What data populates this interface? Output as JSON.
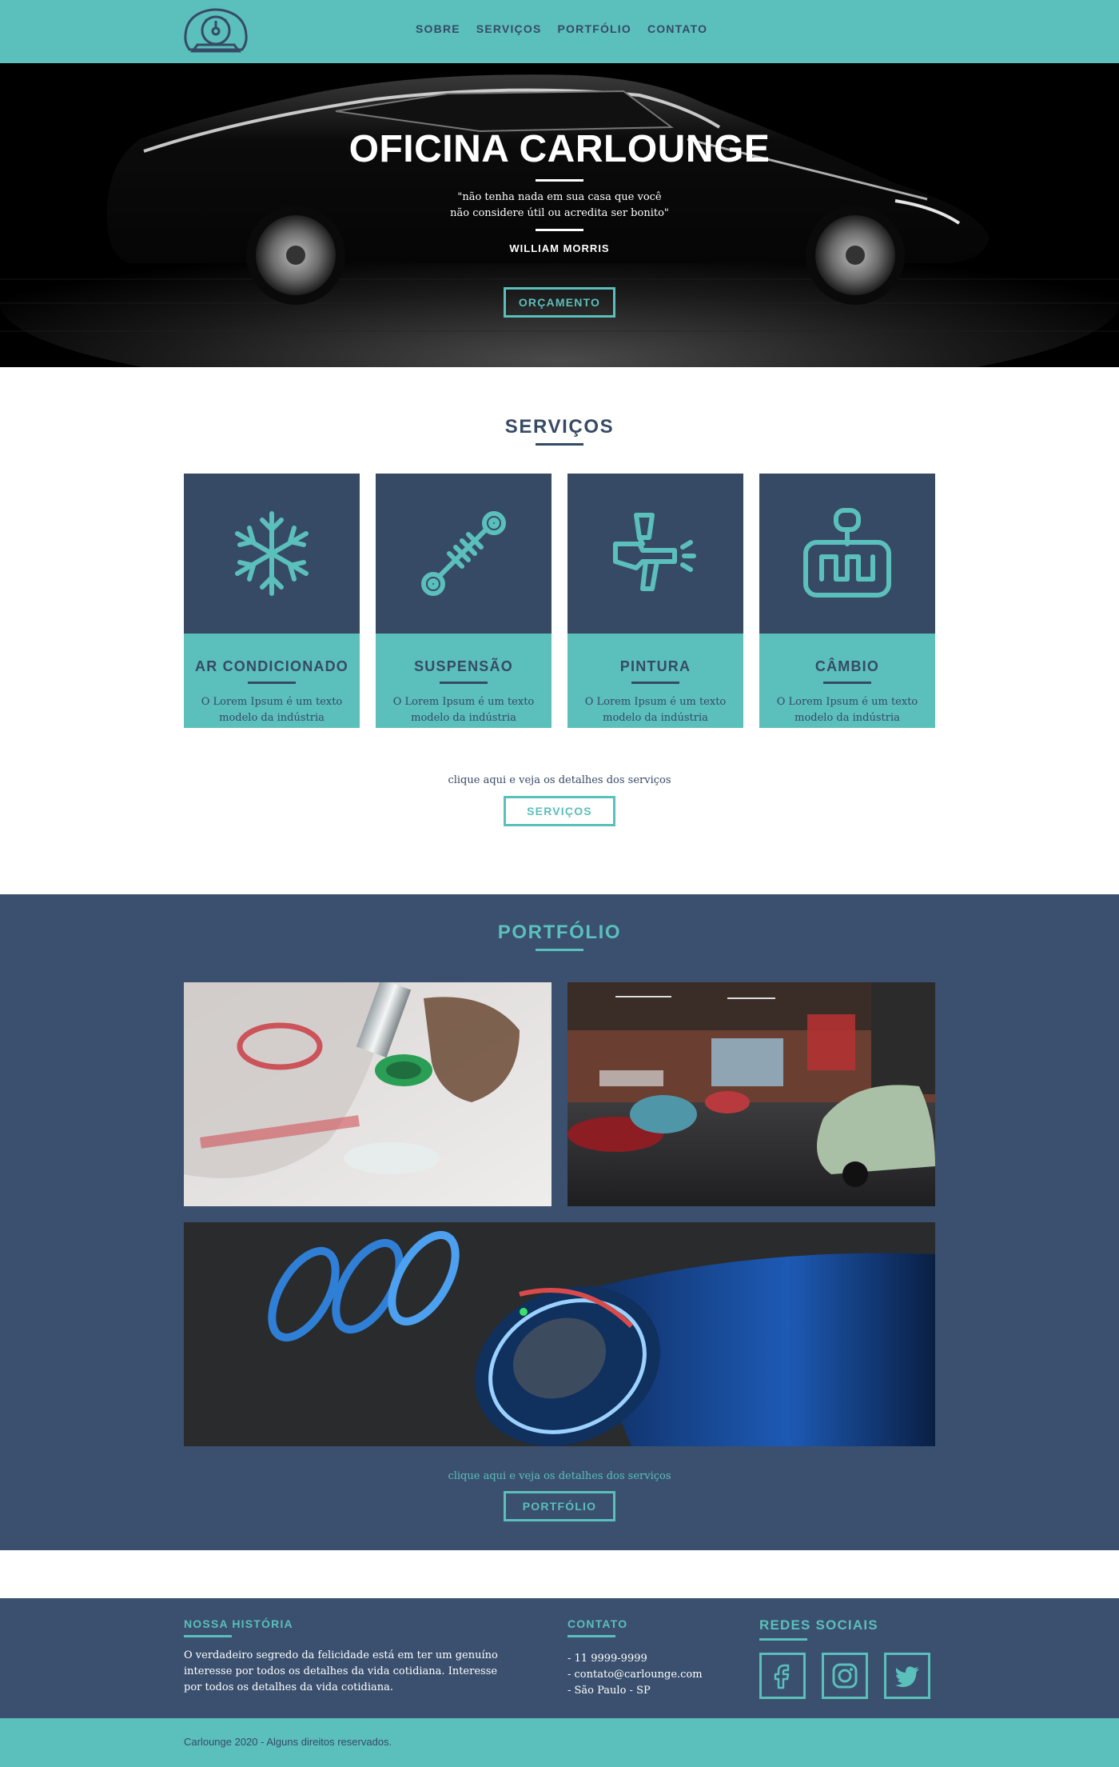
{
  "header": {
    "logo_icon": "speedometer-icon",
    "nav": [
      "SOBRE",
      "SERVIÇOS",
      "PORTFÓLIO",
      "CONTATO"
    ]
  },
  "hero": {
    "title": "OFICINA CARLOUNGE",
    "quote_line1": "\"não tenha nada em sua casa que você",
    "quote_line2": "não considere útil ou acredita ser bonito\"",
    "author": "WILLIAM MORRIS",
    "button": "ORÇAMENTO"
  },
  "services": {
    "title": "SERVIÇOS",
    "cards": [
      {
        "title": "AR CONDICIONADO",
        "text": "O Lorem Ipsum é um texto modelo da indústria",
        "icon": "snowflake-icon"
      },
      {
        "title": "SUSPENSÃO",
        "text": "O Lorem Ipsum é um texto modelo da indústria",
        "icon": "shock-absorber-icon"
      },
      {
        "title": "PINTURA",
        "text": "O Lorem Ipsum é um texto modelo da indústria",
        "icon": "spray-gun-icon"
      },
      {
        "title": "CÂMBIO",
        "text": "O Lorem Ipsum é um texto modelo da indústria",
        "icon": "gearshift-icon"
      }
    ],
    "cta_text": "clique aqui e veja os detalhes dos serviços",
    "button": "SERVIÇOS"
  },
  "portfolio": {
    "title": "PORTFÓLIO",
    "cta_text": "clique aqui e veja os detalhes dos serviços",
    "button": "PORTFÓLIO"
  },
  "footer": {
    "history_title": "NOSSA HISTÓRIA",
    "history_text": "O verdadeiro segredo da felicidade está em ter um genuíno interesse por todos os detalhes da vida cotidiana. Interesse por todos os detalhes da vida cotidiana.",
    "contact_title": "CONTATO",
    "contact_phone": "- 11 9999-9999",
    "contact_email": "- contato@carlounge.com",
    "contact_city": "- São Paulo - SP",
    "social_title": "REDES SOCIAIS",
    "social_icons": [
      "facebook-icon",
      "instagram-icon",
      "twitter-icon"
    ],
    "copyright": "Carlounge 2020 - Alguns direitos reservados."
  },
  "colors": {
    "teal": "#5bbfbc",
    "navy": "#364a66",
    "slate": "#3a506e"
  }
}
